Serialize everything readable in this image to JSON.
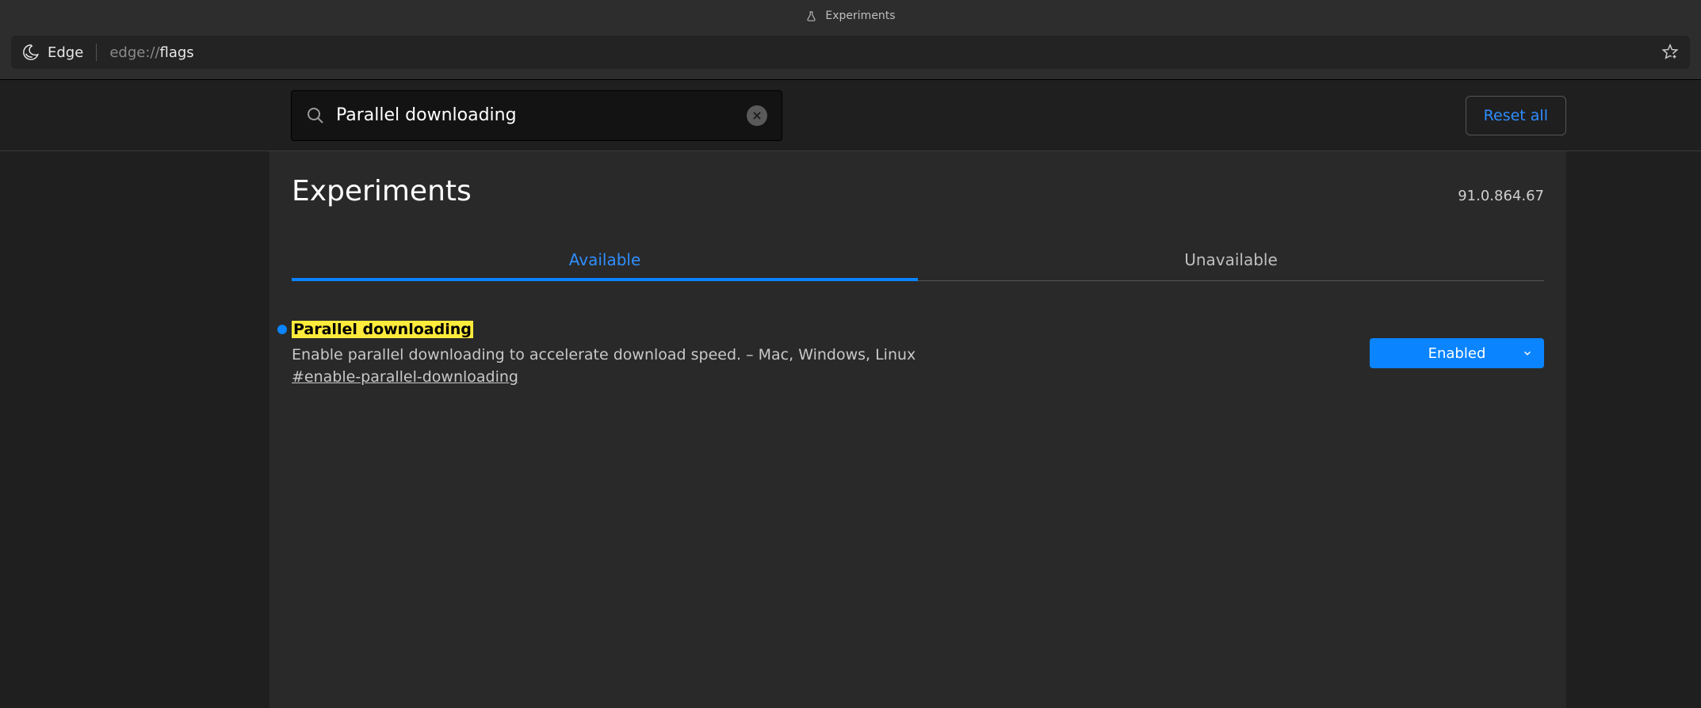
{
  "window": {
    "tab_title": "Experiments"
  },
  "address": {
    "browser_label": "Edge",
    "url_prefix": "edge://",
    "url_suffix": "flags"
  },
  "search": {
    "value": "Parallel downloading",
    "reset_label": "Reset all"
  },
  "page": {
    "heading": "Experiments",
    "version": "91.0.864.67",
    "tabs": {
      "available": "Available",
      "unavailable": "Unavailable"
    }
  },
  "flag": {
    "title": "Parallel downloading",
    "description": "Enable parallel downloading to accelerate download speed. – Mac, Windows, Linux",
    "anchor": "#enable-parallel-downloading",
    "state": "Enabled"
  }
}
